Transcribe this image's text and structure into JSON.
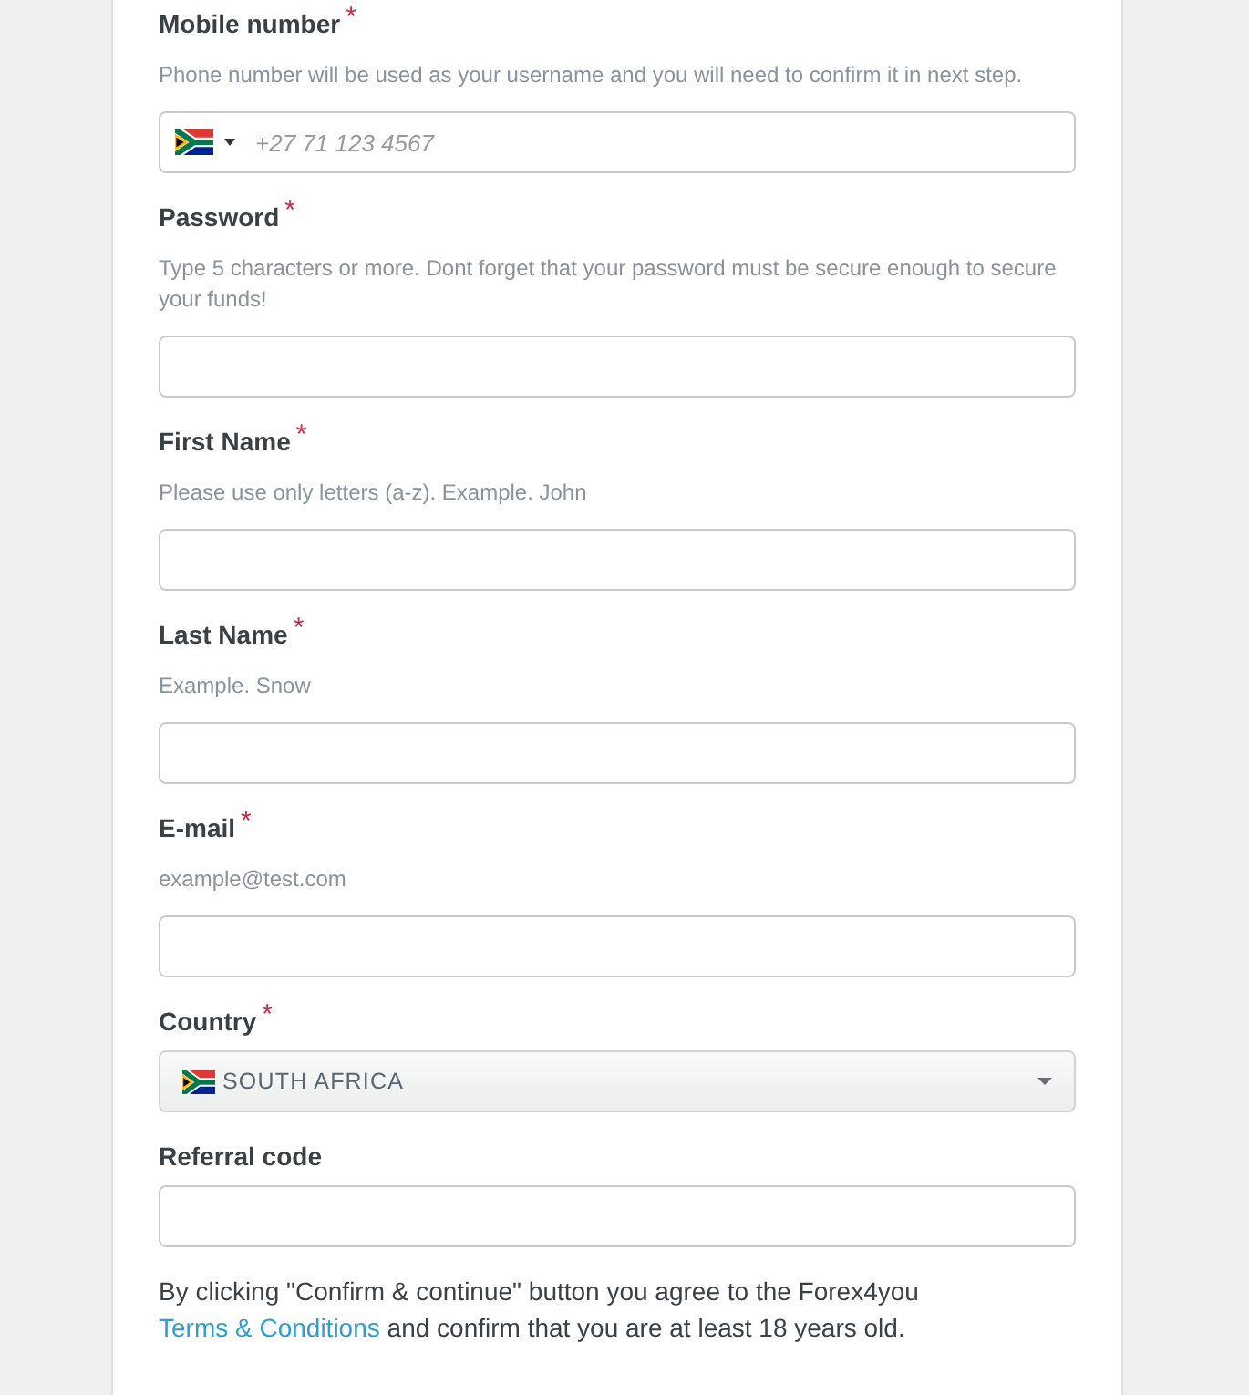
{
  "fields": [
    {
      "kind": "phone",
      "label": "Mobile number",
      "required_mark": "*",
      "hint": "Phone number will be used as your username and you will need to confirm it in next step.",
      "placeholder": "+27 71 123 4567"
    },
    {
      "kind": "text",
      "label": "Password",
      "required_mark": "*",
      "hint": "Type 5 characters or more. Dont forget that your password must be secure enough to secure your funds!"
    },
    {
      "kind": "text",
      "label": "First Name",
      "required_mark": "*",
      "hint": "Please use only letters (a-z). Example. John"
    },
    {
      "kind": "text",
      "label": "Last Name",
      "required_mark": "*",
      "hint": "Example. Snow"
    },
    {
      "kind": "text",
      "label": "E-mail",
      "required_mark": "*",
      "hint": "example@test.com"
    },
    {
      "kind": "select",
      "label": "Country",
      "required_mark": "*",
      "value": "SOUTH AFRICA"
    },
    {
      "kind": "text",
      "label": "Referral code"
    }
  ],
  "agreement": {
    "text_before": "By clicking \"Confirm & continue\" button you agree to the Forex4you",
    "link": "Terms & Conditions",
    "text_after": "and confirm that you are at least 18 years old."
  }
}
